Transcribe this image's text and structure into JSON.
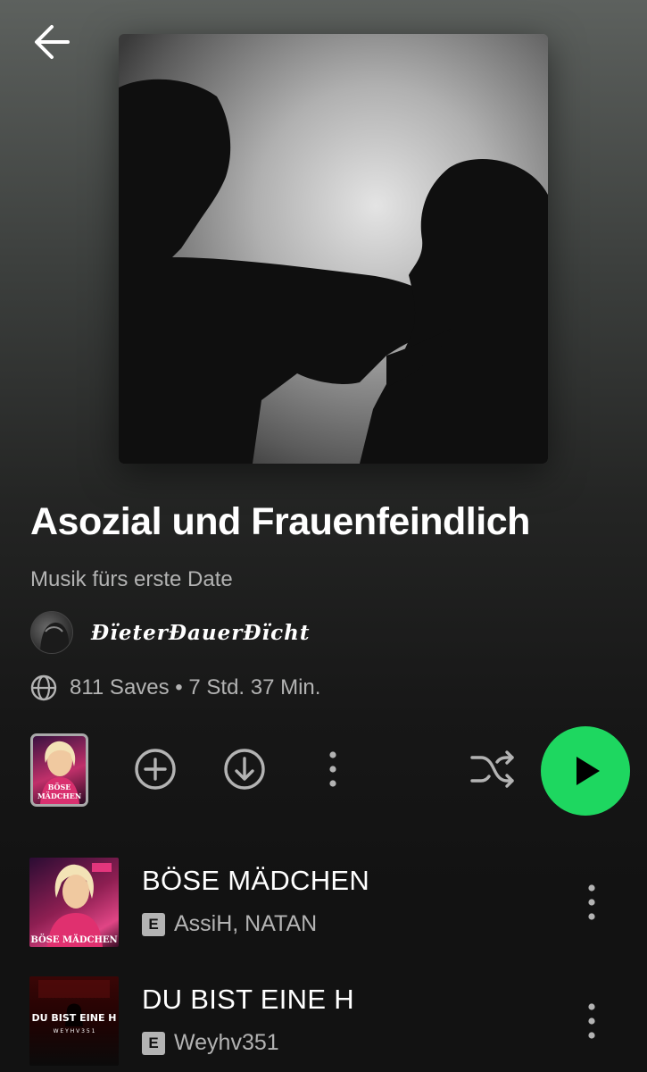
{
  "playlist": {
    "title": "Asozial und Frauenfeindlich",
    "description": "Musik fürs erste Date",
    "owner": "ÐïeterÐauerÐïcht",
    "meta": "811 Saves • 7 Std. 37 Min."
  },
  "icons": {
    "back": "arrow-left-icon",
    "globe": "globe-icon",
    "add": "add-circle-icon",
    "download": "download-icon",
    "more": "more-vertical-icon",
    "shuffle": "shuffle-icon",
    "play": "play-icon"
  },
  "colors": {
    "accent": "#1ed760",
    "text_secondary": "#b3b3b3",
    "background": "#121212"
  },
  "mini_cover": {
    "art_text": "BÖSE MÄDCHEN"
  },
  "tracks": [
    {
      "title": "BÖSE MÄDCHEN",
      "explicit": "E",
      "artists": "AssiH, NATAN",
      "art_text": "BÖSE MÄDCHEN"
    },
    {
      "title": "DU BIST EINE H",
      "explicit": "E",
      "artists": "Weyhv351",
      "art_text": "DU BIST EINE H",
      "art_subtext": "W E Y H V 3 5 1"
    }
  ]
}
